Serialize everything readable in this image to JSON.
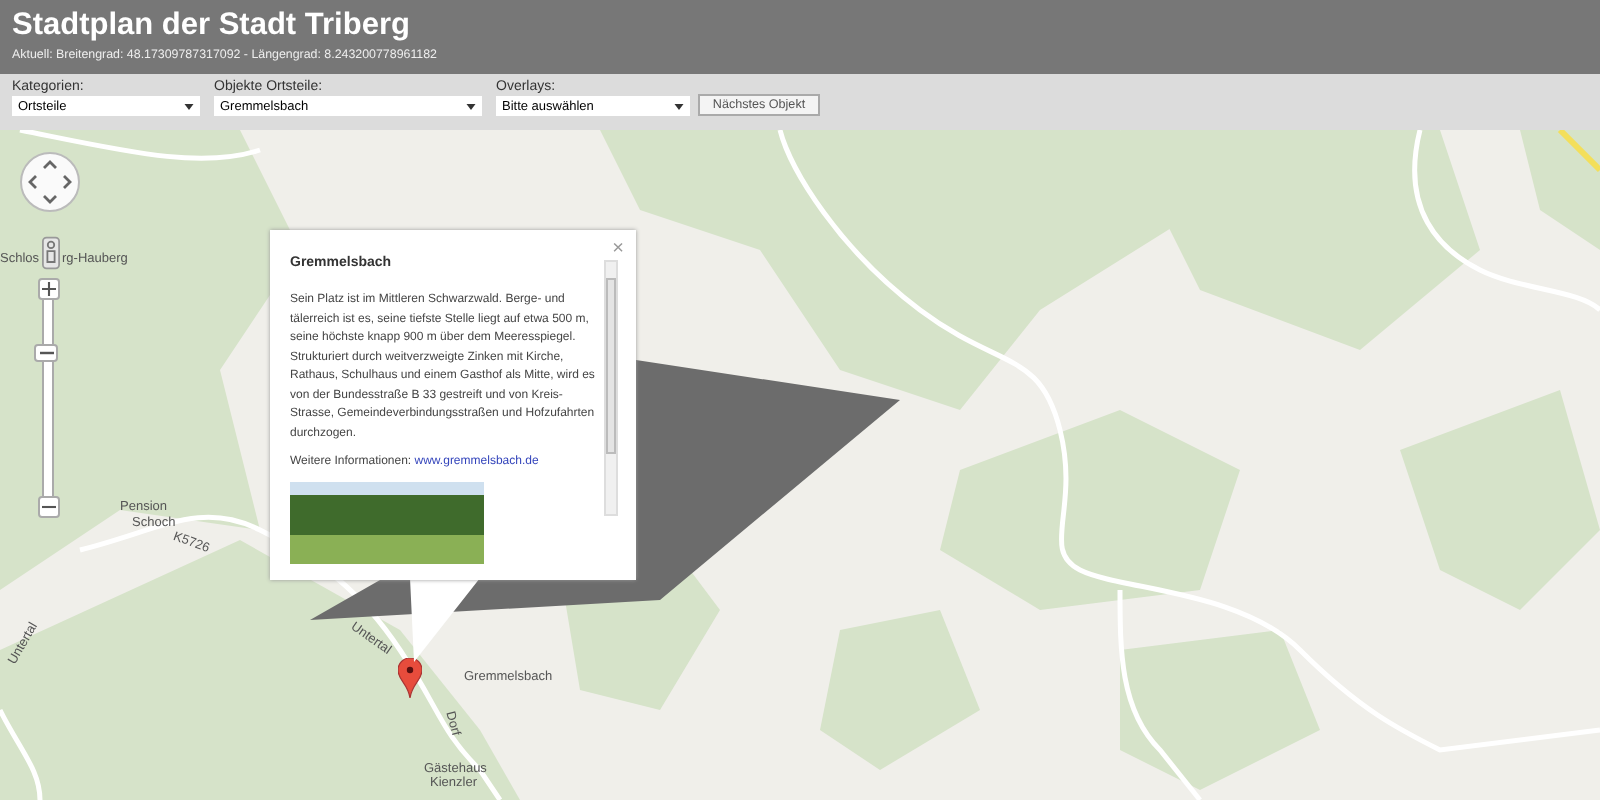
{
  "header": {
    "title": "Stadtplan der Stadt Triberg",
    "coordinates": "Aktuell: Breitengrad: 48.17309787317092 - Längengrad: 8.243200778961182"
  },
  "filters": [
    {
      "label": "Kategorien:",
      "value": "Ortsteile"
    },
    {
      "label": "Objekte Ortsteile:",
      "value": "Gremmelsbach"
    },
    {
      "label": "Overlays:",
      "value": "Bitte auswählen"
    }
  ],
  "next_button": "Nächstes Objekt",
  "map": {
    "zoom_slider": {
      "level": 0.75
    },
    "place_labels": [
      "Schlos",
      "rg-Hauberg",
      "Pension",
      "Schoch",
      "K5726",
      "Untertal",
      "Untertal",
      "Gremmelsbach",
      "Dorf",
      "Gästehaus",
      "Kienzler"
    ],
    "popup": {
      "title": "Gremmelsbach",
      "text": "Sein Platz ist im Mittleren Schwarzwald. Berge- und tälerreich ist es, seine tiefste Stelle liegt auf etwa 500 m, seine höchste knapp 900 m über dem Meeresspiegel. Strukturiert durch weitverzweigte Zinken mit Kirche, Rathaus, Schulhaus und einem Gasthof als Mitte, wird es von der Bundesstraße B 33 gestreift und von Kreis-Strasse, Gemeindeverbindungsstraßen und Hofzufahrten durchzogen.",
      "more_label": "Weitere Informationen:",
      "link": "www.gremmelsbach.de",
      "close": "×"
    }
  }
}
